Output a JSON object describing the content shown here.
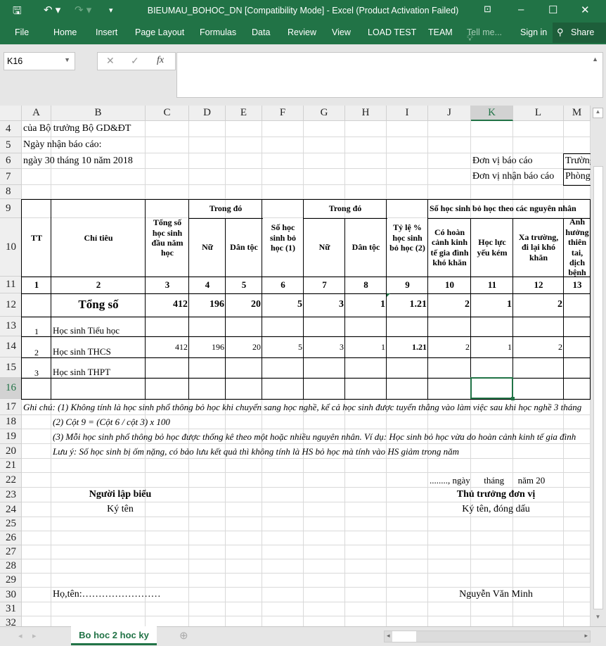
{
  "window": {
    "title": "BIEUMAU_BOHOC_DN  [Compatibility Mode] - Excel (Product Activation Failed)"
  },
  "menu": {
    "items": [
      "File",
      "Home",
      "Insert",
      "Page Layout",
      "Formulas",
      "Data",
      "Review",
      "View",
      "LOAD TEST",
      "TEAM"
    ],
    "tell_me": "Tell me...",
    "sign_in": "Sign in",
    "share": "Share"
  },
  "formula_bar": {
    "name_box": "K16",
    "formula": "",
    "fx": "fx"
  },
  "columns": [
    "A",
    "B",
    "C",
    "D",
    "E",
    "F",
    "G",
    "H",
    "I",
    "J",
    "K",
    "L",
    "M"
  ],
  "selected_cell": {
    "col": "K",
    "row": 16
  },
  "accent": "#217346",
  "cells": {
    "r4": "của Bộ trưởng Bộ GD&ĐT",
    "r5": "Ngày nhận báo cáo:",
    "r6": "ngày 30 tháng 10 năm 2018",
    "don_vi_bc": "Đơn vị báo cáo",
    "don_vi_bc_val": "Trường",
    "don_vi_nhan": "Đơn vị nhận báo cáo",
    "don_vi_nhan_val": "Phòng",
    "header": {
      "tt": "TT",
      "chi_tieu": "Chỉ tiêu",
      "tong_so_hs": "Tổng số học sinh đầu năm học",
      "trong_do_1": "Trong đó",
      "nu_1": "Nữ",
      "dan_toc_1": "Dân tộc",
      "so_hs_bo_hoc": "Số học sinh bỏ học (1)",
      "trong_do_2": "Trong đó",
      "nu_2": "Nữ",
      "dan_toc_2": "Dân tộc",
      "ty_le": "Tỷ lệ % học sinh bỏ học (2)",
      "theo_nguyen_nhan": "Số học sinh bỏ học theo các nguyên nhân",
      "hoan_canh": "Có hoàn cảnh kinh tế gia đình khó khăn",
      "hoc_luc": "Học lực yếu kém",
      "xa_truong": "Xa trường, đi lại khó khăn",
      "anh_huong": "Ảnh hưởng thiên tai, dịch bệnh"
    },
    "col_numbers": [
      "1",
      "2",
      "3",
      "4",
      "5",
      "6",
      "7",
      "8",
      "9",
      "10",
      "11",
      "12",
      "13"
    ],
    "rows": [
      {
        "tt": "",
        "name": "Tổng số",
        "values": [
          "412",
          "196",
          "20",
          "5",
          "3",
          "1",
          "1.21",
          "2",
          "1",
          "2"
        ]
      },
      {
        "tt": "1",
        "name": "Học sinh Tiểu học",
        "values": [
          "",
          "",
          "",
          "",
          "",
          "",
          "",
          "",
          "",
          ""
        ]
      },
      {
        "tt": "2",
        "name": "Học sinh THCS",
        "values": [
          "412",
          "196",
          "20",
          "5",
          "3",
          "1",
          "1.21",
          "2",
          "1",
          "2"
        ]
      },
      {
        "tt": "3",
        "name": "Học sinh THPT",
        "values": [
          "",
          "",
          "",
          "",
          "",
          "",
          "",
          "",
          "",
          ""
        ]
      }
    ],
    "notes": [
      "Ghi chú: (1) Không tính là học sinh phổ thông bỏ học khi chuyển sang học nghề, kể cả học sinh được tuyển thẳng vào làm việc sau khi học nghề 3 tháng",
      "(2) Cột 9 = (Cột 6 / cột 3) x 100",
      "(3) Mỗi học sinh phổ thông bỏ học được thống kê theo một hoặc nhiều nguyên nhân. Ví dụ: Học sinh bỏ học vừa do hoàn cảnh kinh tế gia đình",
      "Lưu ý: Số học sinh bị ốm nặng, có bảo lưu kết quả  thì không tính là HS bỏ học mà tính vào HS giảm trong năm"
    ],
    "date_line": "........, ngày      tháng      năm 20",
    "nguoi_lap": "Người lập biểu",
    "ky_ten": "Ký tên",
    "thu_truong": "Thủ trưởng đơn vị",
    "ky_ten_dong_dau": "Ký tên, đóng dấu",
    "ho_ten": "Họ,tên:……………………",
    "signer": "Nguyễn Văn Minh"
  },
  "sheet_tabs": [
    "Bo hoc 2 hoc ky"
  ]
}
